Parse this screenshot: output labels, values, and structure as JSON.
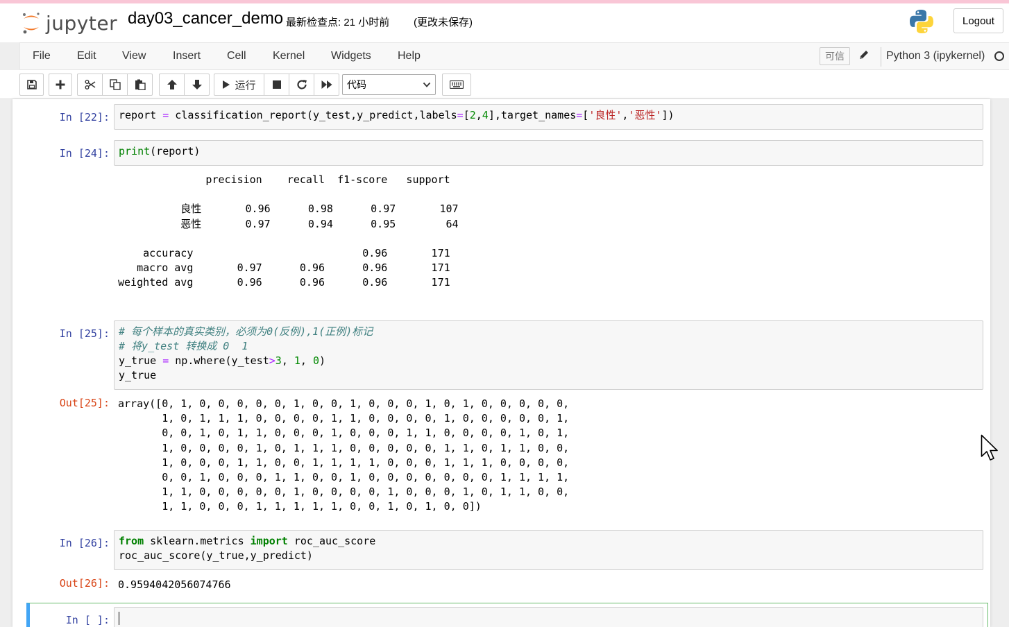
{
  "header": {
    "logo_text": "jupyter",
    "notebook_name": "day03_cancer_demo",
    "checkpoint": "最新检查点: 21 小时前",
    "autosave": "(更改未保存)",
    "logout_label": "Logout"
  },
  "menubar": {
    "items": [
      "File",
      "Edit",
      "View",
      "Insert",
      "Cell",
      "Kernel",
      "Widgets",
      "Help"
    ],
    "trusted_label": "可信",
    "kernel_name": "Python 3 (ipykernel)"
  },
  "toolbar": {
    "run_label": "运行",
    "cell_type": "代码",
    "icons": [
      "save-icon",
      "plus-icon",
      "scissors-icon",
      "copy-icon",
      "paste-icon",
      "arrow-up-icon",
      "arrow-down-icon",
      "play-icon",
      "stop-icon",
      "restart-icon",
      "fast-forward-icon",
      "keyboard-icon"
    ]
  },
  "cells": [
    {
      "prompt": "In  [22]:",
      "code": "report = classification_report(y_test,y_predict,labels=[2,4],target_names=['良性','恶性'])"
    },
    {
      "prompt": "In  [24]:",
      "code": "print(report)",
      "stream": "              precision    recall  f1-score   support\n\n          良性       0.96      0.98      0.97       107\n          恶性       0.97      0.94      0.95        64\n\n    accuracy                           0.96       171\n   macro avg       0.97      0.96      0.96       171\nweighted avg       0.96      0.96      0.96       171"
    },
    {
      "prompt": "In  [25]:",
      "code": "# 每个样本的真实类别，必须为0(反例),1(正例)标记\n# 将y_test 转换成 0  1\ny_true = np.where(y_test>3, 1, 0)\ny_true",
      "out_prompt": "Out[25]:",
      "output": "array([0, 1, 0, 0, 0, 0, 0, 1, 0, 0, 1, 0, 0, 0, 1, 0, 1, 0, 0, 0, 0, 0,\n       1, 0, 1, 1, 1, 0, 0, 0, 0, 1, 1, 0, 0, 0, 0, 1, 0, 0, 0, 0, 0, 1,\n       0, 0, 1, 0, 1, 1, 0, 0, 0, 1, 0, 0, 0, 1, 1, 0, 0, 0, 0, 1, 0, 1,\n       1, 0, 0, 0, 0, 1, 0, 1, 1, 1, 0, 0, 0, 0, 0, 1, 1, 0, 1, 1, 0, 0,\n       1, 0, 0, 0, 1, 1, 0, 0, 1, 1, 1, 1, 0, 0, 0, 1, 1, 1, 0, 0, 0, 0,\n       0, 0, 1, 0, 0, 0, 1, 1, 0, 0, 1, 0, 0, 0, 0, 0, 0, 0, 1, 1, 1, 1,\n       1, 1, 0, 0, 0, 0, 0, 1, 0, 0, 0, 0, 1, 0, 0, 0, 1, 0, 1, 1, 0, 0,\n       1, 1, 0, 0, 0, 1, 1, 1, 1, 1, 0, 0, 1, 0, 1, 0, 0])"
    },
    {
      "prompt": "In  [26]:",
      "code": "from sklearn.metrics import roc_auc_score\nroc_auc_score(y_true,y_predict)",
      "out_prompt": "Out[26]:",
      "output": "0.9594042056074766"
    },
    {
      "prompt": "In  [  ]:",
      "code": ""
    }
  ]
}
